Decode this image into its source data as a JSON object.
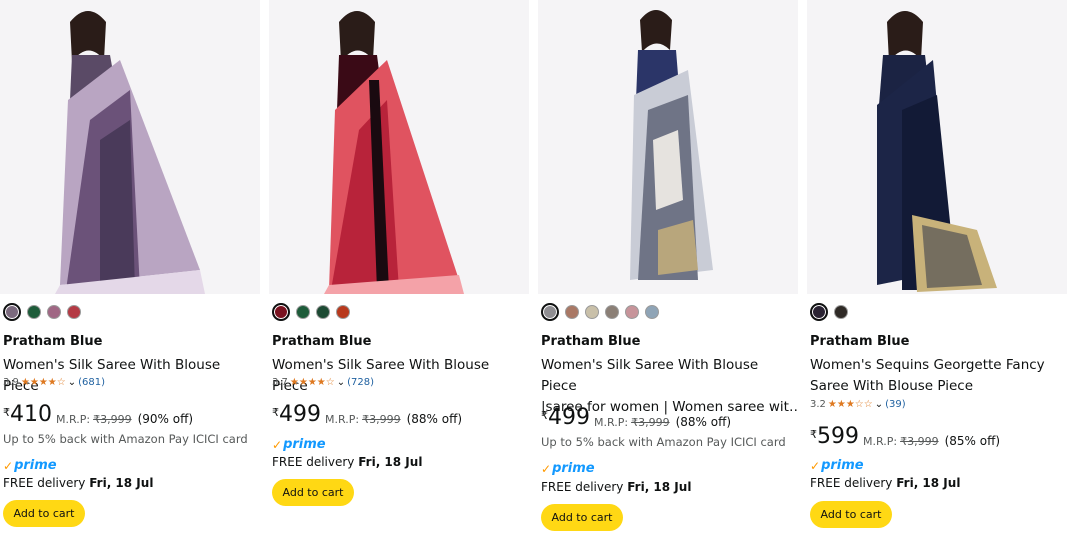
{
  "products": [
    {
      "image_desc": "woman-in-purple-saree",
      "colors": [
        "#7b6a7e",
        "#1e5c3a",
        "#a06784",
        "#b43a44"
      ],
      "brand": "Pratham Blue",
      "title": "Women's Silk Saree With Blouse Piece",
      "title2": "",
      "rating": "3.9",
      "stars": "★★★★☆",
      "rating_count": "(681)",
      "price_symbol": "₹",
      "price": "410",
      "mrp_label": "M.R.P:",
      "mrp": "₹3,999",
      "discount": "(90% off)",
      "cashback": "Up to 5% back with Amazon Pay ICICI card",
      "prime": "prime",
      "delivery_label": "FREE delivery",
      "delivery_date": "Fri, 18 Jul",
      "cart_label": "Add to cart"
    },
    {
      "image_desc": "woman-in-red-saree",
      "colors": [
        "#7a1220",
        "#1e5c3a",
        "#1d4a33",
        "#b8391d"
      ],
      "brand": "Pratham Blue",
      "title": "Women's Silk Saree With Blouse Piece",
      "title2": "",
      "rating": "3.7",
      "stars": "★★★★☆",
      "rating_count": "(728)",
      "price_symbol": "₹",
      "price": "499",
      "mrp_label": "M.R.P:",
      "mrp": "₹3,999",
      "discount": "(88% off)",
      "cashback": "",
      "prime": "prime",
      "delivery_label": "FREE delivery",
      "delivery_date": "Fri, 18 Jul",
      "cart_label": "Add to cart"
    },
    {
      "image_desc": "woman-in-grey-print-saree",
      "colors": [
        "#8f8e92",
        "#a97865",
        "#c9c0a9",
        "#8b7f76",
        "#c7949a",
        "#8fa4b6"
      ],
      "brand": "Pratham Blue",
      "title": "Women's Silk Saree With Blouse Piece",
      "title2": "|saree for women | Women saree wit…",
      "rating": "",
      "stars": "",
      "rating_count": "",
      "price_symbol": "₹",
      "price": "499",
      "mrp_label": "M.R.P:",
      "mrp": "₹3,999",
      "discount": "(88% off)",
      "cashback": "Up to 5% back with Amazon Pay ICICI card",
      "prime": "prime",
      "delivery_label": "FREE delivery",
      "delivery_date": "Fri, 18 Jul",
      "cart_label": "Add to cart"
    },
    {
      "image_desc": "woman-in-navy-sequins-saree",
      "colors": [
        "#2a2333",
        "#2f2a26"
      ],
      "brand": "Pratham Blue",
      "title": "Women's Sequins Georgette Fancy",
      "title2": "Saree With Blouse Piece",
      "rating": "3.2",
      "stars": "★★★☆☆",
      "rating_count": "(39)",
      "price_symbol": "₹",
      "price": "599",
      "mrp_label": "M.R.P:",
      "mrp": "₹3,999",
      "discount": "(85% off)",
      "cashback": "",
      "prime": "prime",
      "delivery_label": "FREE delivery",
      "delivery_date": "Fri, 18 Jul",
      "cart_label": "Add to cart"
    }
  ]
}
